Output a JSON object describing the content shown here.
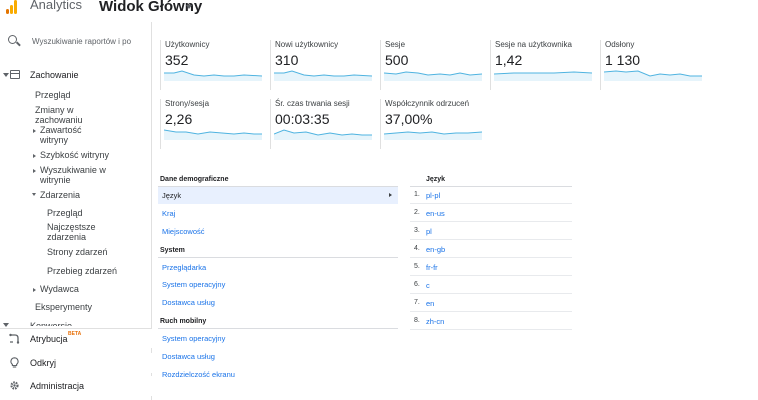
{
  "header": {
    "app_title": "Analytics",
    "view_title": "Widok Główny"
  },
  "search": {
    "placeholder": "Wyszukiwanie raportów i po"
  },
  "sidebar": {
    "section": "Zachowanie",
    "items": {
      "przeglad": "Przegląd",
      "zmiany": "Zmiany w zachowaniu",
      "zawartosc": "Zawartość witryny",
      "szybkosc": "Szybkość witryny",
      "wyszukiwanie": "Wyszukiwanie w witrynie",
      "zdarzenia": "Zdarzenia",
      "ev_przeglad": "Przegląd",
      "ev_najczestsze": "Najczęstsze zdarzenia",
      "ev_strony": "Strony zdarzeń",
      "ev_przebieg": "Przebieg zdarzeń",
      "wydawca": "Wydawca",
      "eksperymenty": "Eksperymenty",
      "konwersje": "Konwersje"
    },
    "bottom": {
      "atrybucja": "Atrybucja",
      "beta": "BETA",
      "odkryj": "Odkryj",
      "administracja": "Administracja"
    }
  },
  "metrics": [
    {
      "label": "Użytkownicy",
      "value": "352"
    },
    {
      "label": "Nowi użytkownicy",
      "value": "310"
    },
    {
      "label": "Sesje",
      "value": "500"
    },
    {
      "label": "Sesje na użytkownika",
      "value": "1,42"
    },
    {
      "label": "Odsłony",
      "value": "1 130"
    },
    {
      "label": "Strony/sesja",
      "value": "2,26"
    },
    {
      "label": "Śr. czas trwania sesji",
      "value": "00:03:35"
    },
    {
      "label": "Współczynnik odrzuceń",
      "value": "37,00%"
    }
  ],
  "demographics": {
    "heading": "Dane demograficzne",
    "items": [
      "Język",
      "Kraj",
      "Miejscowość"
    ],
    "system_heading": "System",
    "system_items": [
      "Przeglądarka",
      "System operacyjny",
      "Dostawca usług"
    ],
    "mobile_heading": "Ruch mobilny",
    "mobile_items": [
      "System operacyjny",
      "Dostawca usług",
      "Rozdzielczość ekranu"
    ]
  },
  "language_table": {
    "heading": "Język",
    "rows": [
      {
        "num": "1.",
        "code": "pl-pl"
      },
      {
        "num": "2.",
        "code": "en-us"
      },
      {
        "num": "3.",
        "code": "pl"
      },
      {
        "num": "4.",
        "code": "en-gb"
      },
      {
        "num": "5.",
        "code": "fr-fr"
      },
      {
        "num": "6.",
        "code": "c"
      },
      {
        "num": "7.",
        "code": "en"
      },
      {
        "num": "8.",
        "code": "zh-cn"
      }
    ]
  },
  "colors": {
    "accent": "#1a73e8",
    "sparkline": "#4fb3e0",
    "sparkline_fill": "#e6f4fb",
    "logo_orange": "#f9ab00",
    "logo_dark": "#e37400"
  }
}
